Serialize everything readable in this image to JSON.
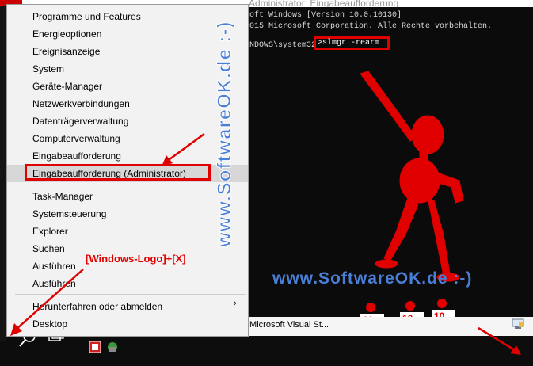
{
  "console": {
    "window_title": "Administrator: Eingabeaufforderung",
    "line1": "oft Windows [Version 10.0.10130]",
    "line2": "015 Microsoft Corporation. Alle Rechte vorbehalten.",
    "prompt": "NDOWS\\system32",
    "command": ">slmgr -rearm"
  },
  "menu": {
    "items": [
      {
        "label": "Programme und Features"
      },
      {
        "label": "Energieoptionen"
      },
      {
        "label": "Ereignisanzeige"
      },
      {
        "label": "System"
      },
      {
        "label": "Geräte-Manager"
      },
      {
        "label": "Netzwerkverbindungen"
      },
      {
        "label": "Datenträgerverwaltung"
      },
      {
        "label": "Computerverwaltung"
      },
      {
        "label": "Eingabeaufforderung"
      },
      {
        "label": "Eingabeaufforderung (Administrator)"
      },
      {
        "label": "Task-Manager"
      },
      {
        "label": "Systemsteuerung"
      },
      {
        "label": "Explorer"
      },
      {
        "label": "Suchen"
      },
      {
        "label": "Ausführen"
      },
      {
        "label": "Ausführen"
      },
      {
        "label": "Herunterfahren oder abmelden"
      },
      {
        "label": "Desktop"
      }
    ],
    "submenu_arrow": "›"
  },
  "annotations": {
    "shortcut": "[Windows-Logo]+[X]",
    "watermark_vertical": "www.SoftwareOK.de :-)",
    "watermark_horizontal": "www.SoftwareOK.de :-)"
  },
  "taskbar": {
    "vs_label": "\\Microsoft Visual St..."
  },
  "colors": {
    "annotation_red": "#e00000",
    "watermark_blue": "#4a7fd8",
    "menu_bg": "#f2f2f2",
    "console_bg": "#0b0b0b"
  }
}
